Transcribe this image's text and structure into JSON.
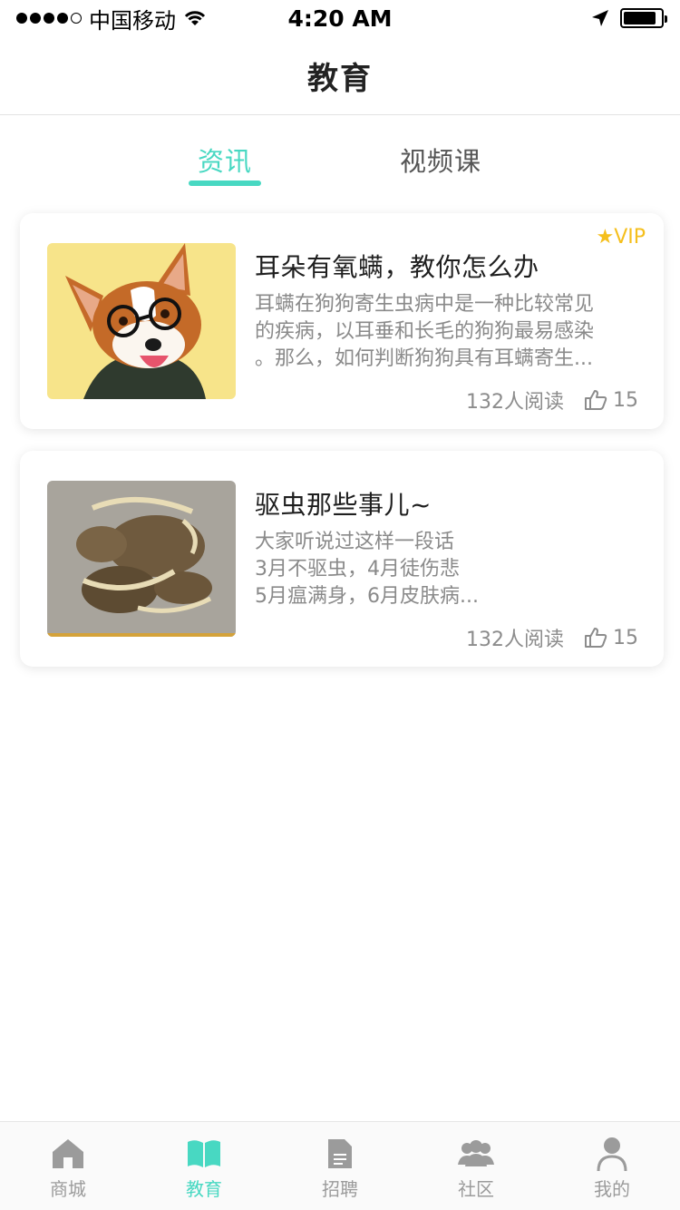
{
  "status_bar": {
    "carrier": "中国移动",
    "time": "4:20 AM"
  },
  "header": {
    "title": "教育"
  },
  "tabs": [
    {
      "label": "资讯",
      "active": true
    },
    {
      "label": "视频课",
      "active": false
    }
  ],
  "articles": [
    {
      "title": "耳朵有氧螨，教你怎么办",
      "desc": [
        "耳螨在狗狗寄生虫病中是一种比较常见",
        "的疾病，以耳垂和长毛的狗狗最易感染",
        "。那么，如何判断狗狗具有耳螨寄生..."
      ],
      "reads": "132人阅读",
      "likes": "15",
      "vip": "★VIP",
      "image": "corgi-with-glasses"
    },
    {
      "title": "驱虫那些事儿~",
      "desc": [
        "大家听说过这样一段话",
        "3月不驱虫，4月徒伤悲",
        "5月瘟满身，6月皮肤病..."
      ],
      "reads": "132人阅读",
      "likes": "15",
      "image": "parasite-worms"
    }
  ],
  "tab_bar": {
    "items": [
      {
        "label": "商城",
        "icon": "home-icon",
        "active": false
      },
      {
        "label": "教育",
        "icon": "book-icon",
        "active": true
      },
      {
        "label": "招聘",
        "icon": "document-icon",
        "active": false
      },
      {
        "label": "社区",
        "icon": "group-icon",
        "active": false
      },
      {
        "label": "我的",
        "icon": "person-icon",
        "active": false
      }
    ]
  },
  "colors": {
    "accent": "#48d8c2",
    "vip": "#f5bf1c",
    "text_secondary": "#8a8a8a"
  }
}
